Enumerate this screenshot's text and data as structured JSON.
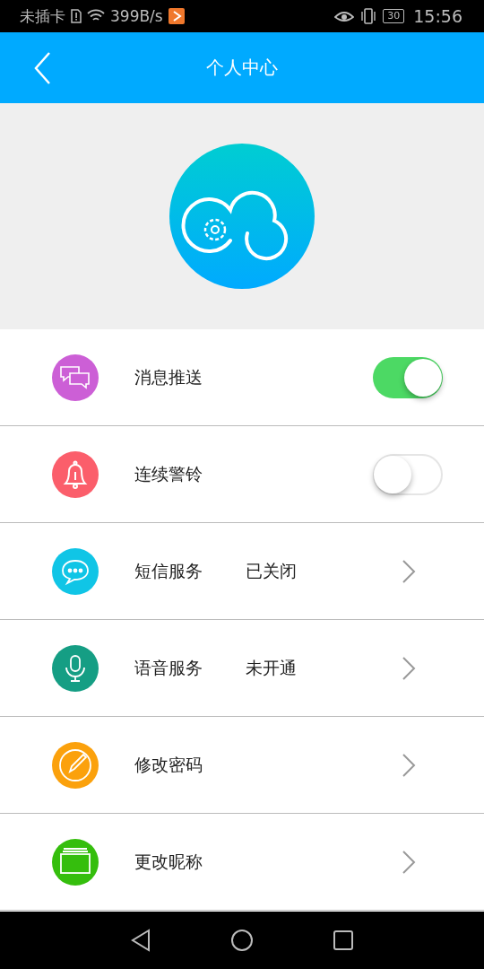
{
  "status_bar": {
    "carrier": "未插卡",
    "speed": "399B/s",
    "battery": "30",
    "time": "15:56"
  },
  "header": {
    "title": "个人中心"
  },
  "items": [
    {
      "kind": "toggle",
      "label": "消息推送",
      "on": true,
      "color": "#cc5fd6"
    },
    {
      "kind": "toggle",
      "label": "连续警铃",
      "on": false,
      "color": "#fb5e6b"
    },
    {
      "kind": "link",
      "label": "短信服务",
      "status": "已关闭",
      "color": "#10c5e6"
    },
    {
      "kind": "link",
      "label": "语音服务",
      "status": "未开通",
      "color": "#159e84"
    },
    {
      "kind": "link",
      "label": "修改密码",
      "color": "#fba10c"
    },
    {
      "kind": "link",
      "label": "更改昵称",
      "color": "#35be0d"
    }
  ]
}
